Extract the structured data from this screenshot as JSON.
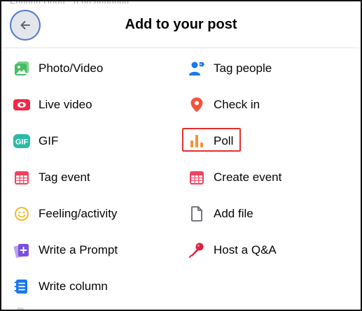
{
  "dialog": {
    "title": "Add to your post",
    "back_icon": "arrow-left-icon",
    "background_peek_text": "Ehhhhh Hhhh · h hh hhhhhhh"
  },
  "options": [
    {
      "id": "photo-video",
      "label": "Photo/Video",
      "icon": "photo-icon",
      "color": "#45bd62"
    },
    {
      "id": "tag-people",
      "label": "Tag people",
      "icon": "tag-people-icon",
      "color": "#1877f2"
    },
    {
      "id": "live-video",
      "label": "Live video",
      "icon": "live-video-icon",
      "color": "#f02849"
    },
    {
      "id": "check-in",
      "label": "Check in",
      "icon": "location-pin-icon",
      "color": "#f5533d"
    },
    {
      "id": "gif",
      "label": "GIF",
      "icon": "gif-icon",
      "color": "#2abba7"
    },
    {
      "id": "poll",
      "label": "Poll",
      "icon": "poll-icon",
      "color": "#f7923b",
      "highlighted": true
    },
    {
      "id": "tag-event",
      "label": "Tag event",
      "icon": "calendar-icon",
      "color": "#f3425f"
    },
    {
      "id": "create-event",
      "label": "Create event",
      "icon": "calendar-icon",
      "color": "#f3425f"
    },
    {
      "id": "feeling-activity",
      "label": "Feeling/activity",
      "icon": "smiley-icon",
      "color": "#f7b928"
    },
    {
      "id": "add-file",
      "label": "Add file",
      "icon": "file-icon",
      "color": "#65676b"
    },
    {
      "id": "write-a-prompt",
      "label": "Write a Prompt",
      "icon": "prompt-icon",
      "color": "#7b4fe0"
    },
    {
      "id": "host-qa",
      "label": "Host a Q&A",
      "icon": "microphone-icon",
      "color": "#e41e3f"
    },
    {
      "id": "write-column",
      "label": "Write column",
      "icon": "document-icon",
      "color": "#1877f2"
    }
  ]
}
